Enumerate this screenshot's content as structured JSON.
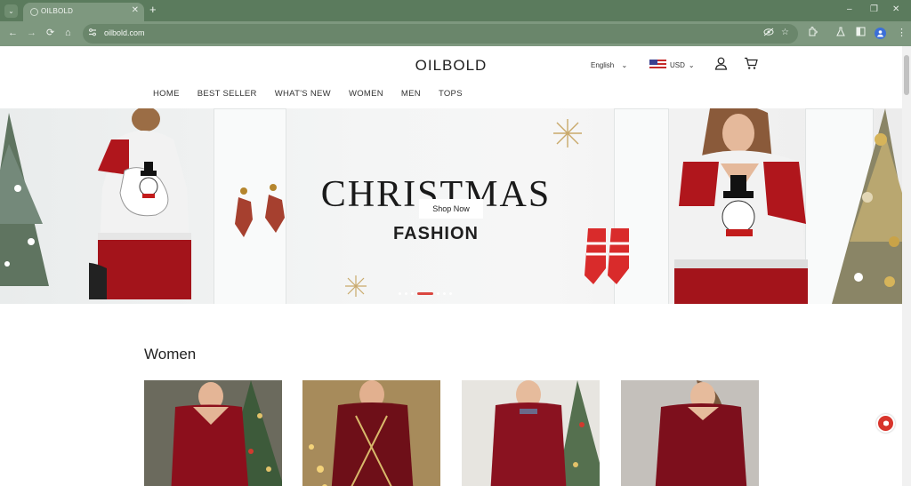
{
  "browser": {
    "tab_title": "OILBOLD",
    "url": "oilbold.com",
    "tab_close": "✕",
    "new_tab": "+",
    "tab_menu": "⌄",
    "window_controls": {
      "minimize": "–",
      "maximize": "❐",
      "close": "✕"
    },
    "nav_icons": {
      "back": "←",
      "forward": "→",
      "reload": "⟳",
      "home": "⌂"
    },
    "toolbar_icons": [
      "tracking-off-icon",
      "bookmark-star-icon",
      "extensions-icon",
      "labs-icon",
      "side-panel-icon",
      "profile-icon",
      "menu-icon"
    ]
  },
  "header": {
    "logo": "OILBOLD",
    "language": "English",
    "currency": "USD",
    "nav": [
      "HOME",
      "BEST SELLER",
      "WHAT'S NEW",
      "WOMEN",
      "MEN",
      "TOPS"
    ]
  },
  "banner": {
    "headline": "CHRISTMAS",
    "subheadline": "FASHION",
    "cta": "Shop Now",
    "slide_count": 7,
    "active_slide": 4
  },
  "section": {
    "title": "Women",
    "products": [
      "women-product-1",
      "women-product-2",
      "women-product-3",
      "women-product-4"
    ]
  },
  "colors": {
    "chrome_dark": "#5b7b5d",
    "chrome_light": "#7e987f",
    "accent_red": "#d7342c",
    "text": "#222222"
  }
}
